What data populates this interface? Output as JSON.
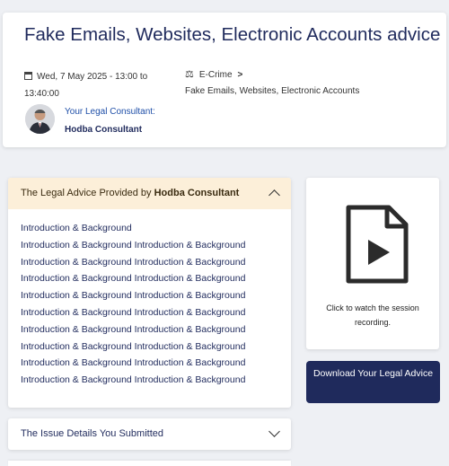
{
  "session": {
    "title": "Fake Emails, Websites, Electronic Accounts advice",
    "date": "Wed, 7 May 2025 - 13:00 to 13:40:00",
    "category": "E-Crime",
    "subcategory": "Fake Emails, Websites, Electronic Accounts",
    "consultant_label": "Your Legal Consultant:",
    "consultant_name": "Hodba Consultant"
  },
  "advice": {
    "header_prefix": "The Legal Advice Provided by",
    "header_name": "Hodba Consultant",
    "lines": [
      "Introduction & Background",
      "Introduction & Background Introduction & Background",
      "Introduction & Background Introduction & Background",
      "Introduction & Background Introduction & Background",
      "Introduction & Background Introduction & Background",
      "Introduction & Background Introduction & Background",
      "Introduction & Background Introduction & Background",
      "Introduction & Background Introduction & Background",
      "Introduction & Background Introduction & Background",
      "Introduction & Background Introduction & Background"
    ]
  },
  "issue": {
    "label": "The Issue Details You Submitted"
  },
  "recording": {
    "text": "Click to watch the session recording."
  },
  "download": {
    "label": "Download Your Legal Advice"
  },
  "colors": {
    "primary": "#1f2a5c",
    "advice_header_bg": "#fcefd9",
    "link": "#1f4fa8"
  },
  "icons": [
    "calendar-icon",
    "scales-icon",
    "chevron-right-icon",
    "chevron-up-icon",
    "chevron-down-icon",
    "video-file-icon"
  ]
}
